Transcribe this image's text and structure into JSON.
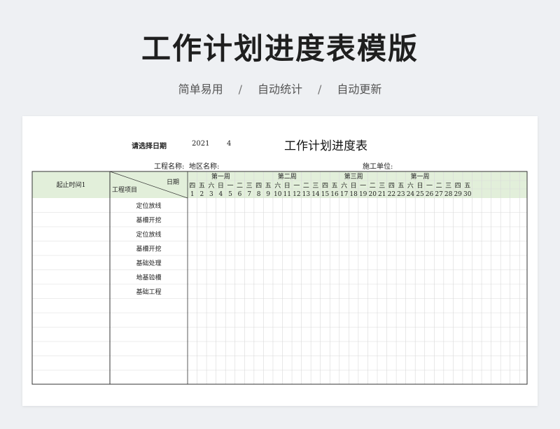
{
  "title": "工作计划进度表模版",
  "subtitle": {
    "items": [
      "简单易用",
      "自动统计",
      "自动更新"
    ],
    "separator": "/"
  },
  "sheet": {
    "title": "工作计划进度表",
    "select_date_label": "请选择日期",
    "year": "2021",
    "month": "4",
    "project_name_label": "工程名称:",
    "region_name_label": "地区名称:",
    "contractor_label": "施工单位:",
    "col_time_header": "起止时间1",
    "col_project_header": "工程项目",
    "col_date_header": "日期",
    "week_labels": [
      "第一周",
      "第二周",
      "第三周",
      "第一周"
    ],
    "weekdays": [
      "四",
      "五",
      "六",
      "日",
      "一",
      "二",
      "三",
      "四",
      "五",
      "六",
      "日",
      "一",
      "二",
      "三",
      "四",
      "五",
      "六",
      "日",
      "一",
      "二",
      "三",
      "四",
      "五",
      "六",
      "日",
      "一",
      "二",
      "三",
      "四",
      "五"
    ],
    "days": [
      "1",
      "2",
      "3",
      "4",
      "5",
      "6",
      "7",
      "8",
      "9",
      "10",
      "11",
      "12",
      "13",
      "14",
      "15",
      "16",
      "17",
      "18",
      "19",
      "20",
      "21",
      "22",
      "23",
      "24",
      "25",
      "26",
      "27",
      "28",
      "29",
      "30"
    ],
    "tasks": [
      "定位放线",
      "基槽开挖",
      "定位放线",
      "基槽开挖",
      "基础处理",
      "地基验槽",
      "基础工程"
    ],
    "colors": {
      "header_fill": "#e2efda",
      "border_dark": "#333333",
      "grid_light": "#d9d9d9"
    }
  }
}
